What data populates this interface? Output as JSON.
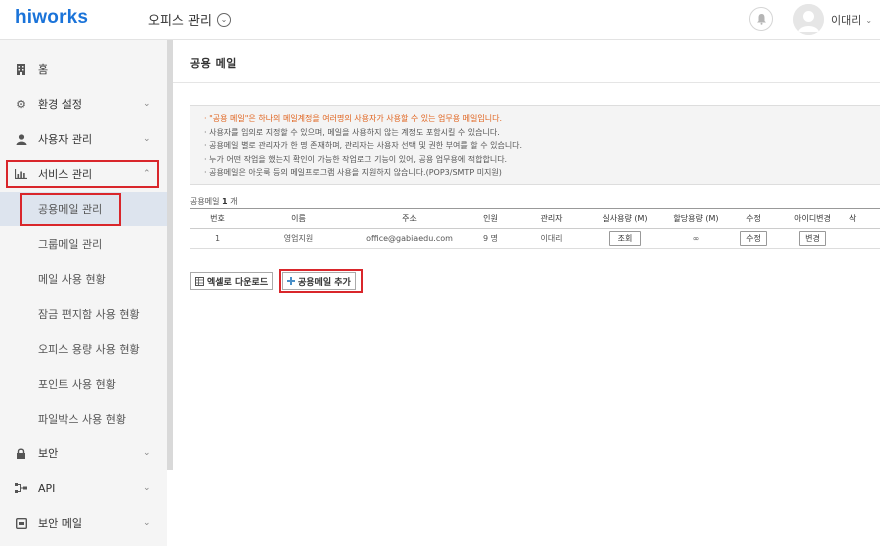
{
  "header": {
    "logo": "hiworks",
    "office_menu": "오피스 관리",
    "user_name": "이대리"
  },
  "sidebar": {
    "items": [
      {
        "label": "홈",
        "icon": "building-icon"
      },
      {
        "label": "환경 설정",
        "icon": "gear-icon"
      },
      {
        "label": "사용자 관리",
        "icon": "user-icon"
      },
      {
        "label": "서비스 관리",
        "icon": "chart-icon"
      },
      {
        "label": "보안",
        "icon": "lock-icon"
      },
      {
        "label": "API",
        "icon": "api-icon"
      },
      {
        "label": "보안 메일",
        "icon": "mail-security-icon"
      }
    ],
    "sub_items": [
      {
        "label": "공용메일 관리"
      },
      {
        "label": "그룹메일 관리"
      },
      {
        "label": "메일 사용 현황"
      },
      {
        "label": "잠금 편지함 사용 현황"
      },
      {
        "label": "오피스 용량 사용 현황"
      },
      {
        "label": "포인트 사용 현황"
      },
      {
        "label": "파일박스 사용 현황"
      }
    ]
  },
  "main": {
    "title": "공용 메일",
    "notice": [
      "· \"공용 메일\"은 하나의 메일계정을 여러명의 사용자가 사용할 수 있는 업무용 메일입니다.",
      "· 사용자를 임의로 지정할 수 있으며, 메일을 사용하지 않는 계정도 포함시킬 수 있습니다.",
      "· 공용메일 별로 관리자가 한 명 존재하며, 관리자는 사용자 선택 및 권한 부여를 할 수 있습니다.",
      "· 누가 어떤 작업을 했는지 확인이 가능한 작업로그 기능이 있어, 공용 업무용에 적합합니다.",
      "· 공용메일은 아웃룩 등의 메일프로그램 사용을 지원하지 않습니다.(POP3/SMTP 미지원)"
    ],
    "count_label": "공용메일",
    "count_value": "1",
    "count_unit": "개",
    "table": {
      "headers": [
        "번호",
        "이름",
        "주소",
        "인원",
        "관리자",
        "실사용량 (M)",
        "할당용량 (M)",
        "수정",
        "아이디변경",
        "삭"
      ],
      "rows": [
        {
          "no": "1",
          "name": "영업지원",
          "address": "office@gabiaedu.com",
          "members": "9 명",
          "admin": "이대리",
          "usage_btn": "조회",
          "quota": "∞",
          "edit_btn": "수정",
          "id_btn": "변경"
        }
      ]
    },
    "excel_button": "엑셀로 다운로드",
    "add_button": "공용메일 추가"
  }
}
